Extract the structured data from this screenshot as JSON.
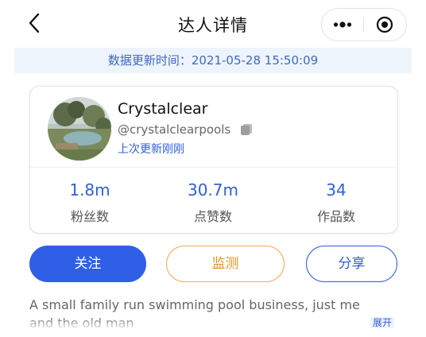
{
  "header": {
    "title": "达人详情",
    "back_icon": "chevron-left-icon",
    "more_icon": "more-dots-icon",
    "close_icon": "target-close-icon"
  },
  "update_bar": {
    "text": "数据更新时间：2021-05-28 15:50:09"
  },
  "profile": {
    "name": "Crystalclear",
    "handle": "@crystalclearpools",
    "last_update": "上次更新刚刚",
    "copy_icon": "copy-icon",
    "avatar": "avatar-photo"
  },
  "stats": [
    {
      "value": "1.8m",
      "label": "粉丝数"
    },
    {
      "value": "30.7m",
      "label": "点赞数"
    },
    {
      "value": "34",
      "label": "作品数"
    }
  ],
  "actions": {
    "follow": "关注",
    "monitor": "监测",
    "share": "分享"
  },
  "bio": {
    "text": "A small family run swimming pool business, just me and the old man",
    "expand_label": "展开"
  },
  "colors": {
    "accent": "#2f5fe6",
    "link": "#2f5fd6",
    "monitor": "#e1922c",
    "update_bar_bg": "#eef4fc"
  }
}
